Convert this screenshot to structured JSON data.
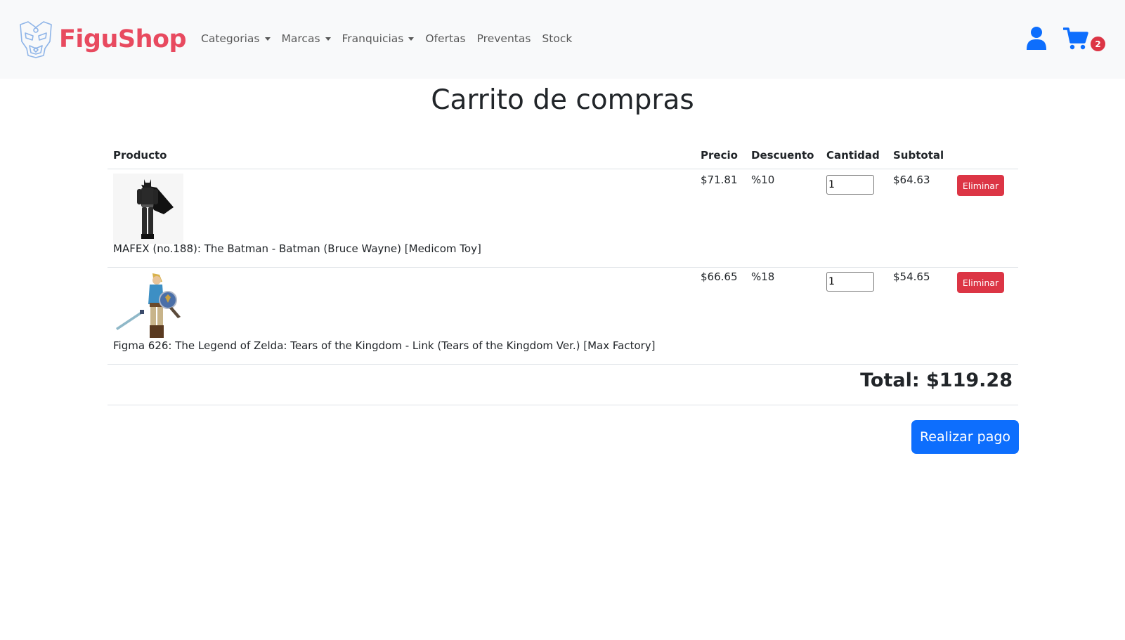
{
  "navbar": {
    "brand": "FiguShop",
    "links": [
      {
        "label": "Categorias",
        "dropdown": true
      },
      {
        "label": "Marcas",
        "dropdown": true
      },
      {
        "label": "Franquicias",
        "dropdown": true
      },
      {
        "label": "Ofertas",
        "dropdown": false
      },
      {
        "label": "Preventas",
        "dropdown": false
      },
      {
        "label": "Stock",
        "dropdown": false
      }
    ],
    "cart_count": "2",
    "icons": {
      "user": "user-icon",
      "cart": "shopping-cart-icon"
    }
  },
  "page": {
    "title": "Carrito de compras"
  },
  "table": {
    "headers": {
      "product": "Producto",
      "price": "Precio",
      "discount": "Descuento",
      "quantity": "Cantidad",
      "subtotal": "Subtotal"
    },
    "rows": [
      {
        "name": "MAFEX (no.188): The Batman - Batman (Bruce Wayne) [Medicom Toy]",
        "price": "$71.81",
        "discount": "%10",
        "quantity": "1",
        "subtotal": "$64.63",
        "delete_label": "Eliminar"
      },
      {
        "name": "Figma 626: The Legend of Zelda: Tears of the Kingdom - Link (Tears of the Kingdom Ver.) [Max Factory]",
        "price": "$66.65",
        "discount": "%18",
        "quantity": "1",
        "subtotal": "$54.65",
        "delete_label": "Eliminar"
      }
    ],
    "total": "Total: $119.28"
  },
  "actions": {
    "pay_label": "Realizar pago"
  },
  "colors": {
    "brand": "#e84a5f",
    "primary": "#0d6efd",
    "danger": "#dc3545",
    "navbar_bg": "#f8f9fa"
  }
}
